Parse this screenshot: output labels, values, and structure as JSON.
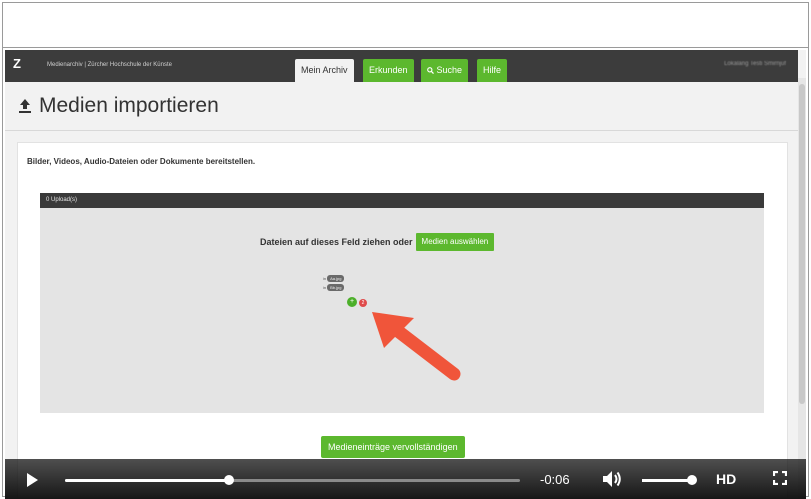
{
  "nav": {
    "logo": "Z",
    "brand": "Medienarchiv | Zürcher Hochschule der Künste",
    "tabs": {
      "archiv": "Mein Archiv",
      "erkunden": "Erkunden",
      "suche": "Suche",
      "hilfe": "Hilfe"
    },
    "user": "Lokalang Testi Smirnjuf"
  },
  "page": {
    "title": "Medien importieren",
    "intro": "Bilder, Videos, Audio-Dateien oder Dokumente bereitstellen."
  },
  "upload": {
    "status": "0 Upload(s)",
    "drop_text": "Dateien auf dieses Feld ziehen oder",
    "select_button": "Medien auswählen",
    "drag_files": [
      {
        "tag": "in",
        "name": "Aa.jpg"
      },
      {
        "tag": "in",
        "name": "Bb.jpg"
      }
    ],
    "plus": "+",
    "count": "2"
  },
  "complete_button": "Medieneinträge vervollständigen",
  "player": {
    "time": "-0:06",
    "quality": "HD",
    "progress": 0.36,
    "volume": 1.0
  },
  "colors": {
    "accent_green": "#5cb82e",
    "nav_bg": "#3c3c3c",
    "annotation_arrow": "#f0553a"
  }
}
